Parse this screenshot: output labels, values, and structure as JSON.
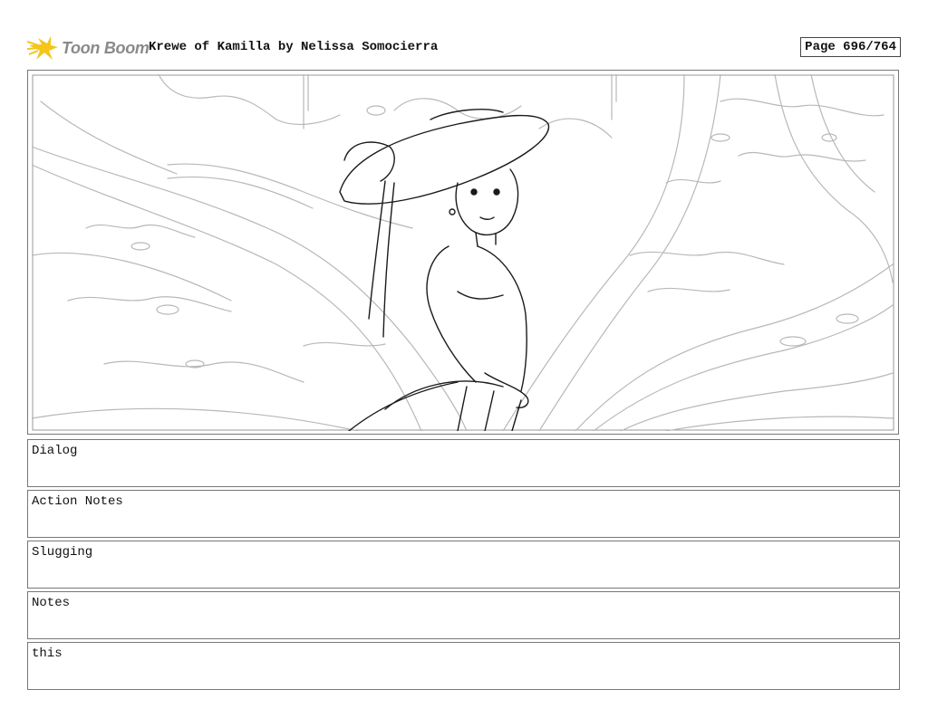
{
  "header": {
    "logo_text": "Toon Boom",
    "project_title": "Krewe of Kamilla by Nelissa Somocierra",
    "page_number": "Page 696/764"
  },
  "panel": {
    "image_description_icon": "storyboard-sketch-image"
  },
  "fields": [
    {
      "label": "Dialog"
    },
    {
      "label": "Action Notes"
    },
    {
      "label": "Slugging"
    },
    {
      "label": "Notes"
    },
    {
      "label": "this"
    }
  ],
  "colors": {
    "logo_yellow": "#f5c518",
    "logo_gray": "#8a8a8a",
    "sketch_light": "#b8b8b8",
    "sketch_dark": "#1a1a1a",
    "border": "#777777"
  }
}
